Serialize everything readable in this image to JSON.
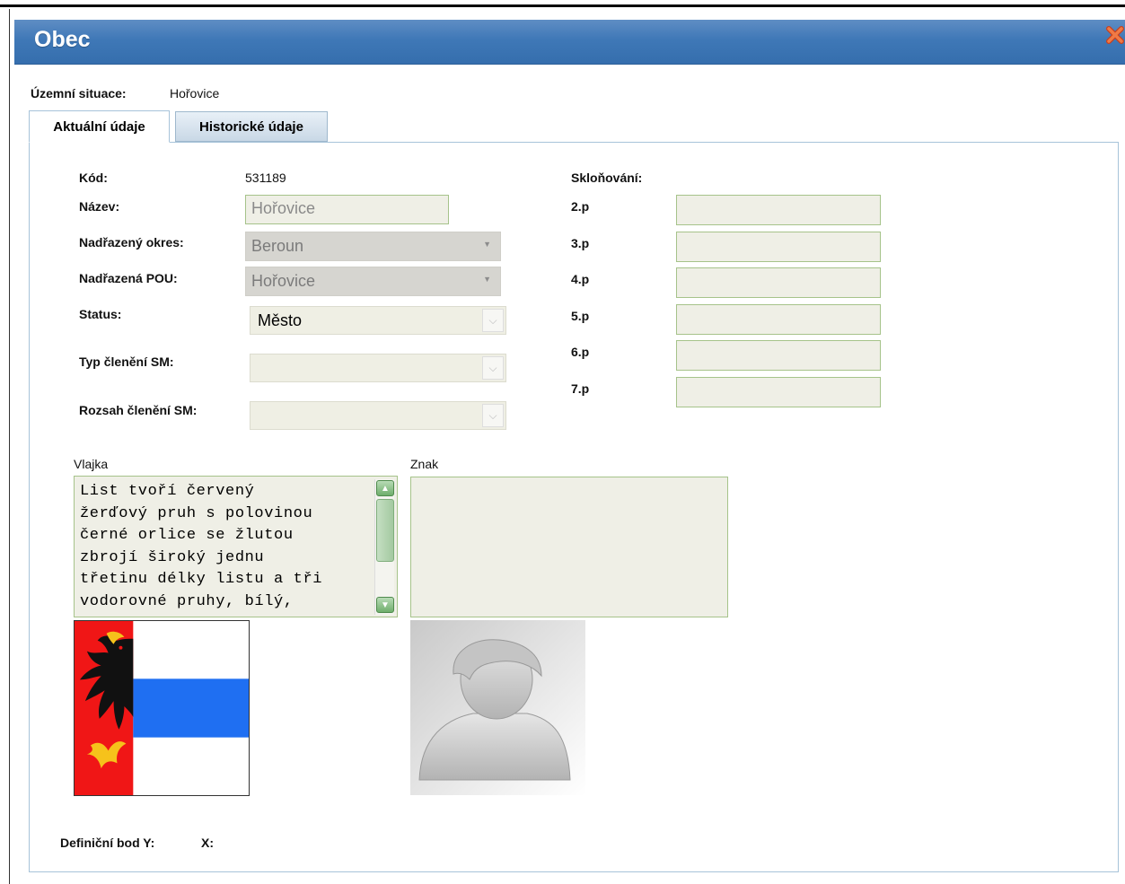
{
  "window": {
    "title": "Obec"
  },
  "territorial_situation": {
    "label": "Územní situace:",
    "value": "Hořovice"
  },
  "tabs": [
    {
      "label": "Aktuální údaje",
      "active": true
    },
    {
      "label": "Historické údaje",
      "active": false
    }
  ],
  "form": {
    "kod_label": "Kód:",
    "kod_value": "531189",
    "nazev_label": "Název:",
    "nazev_value": "Hořovice",
    "okres_label": "Nadřazený okres:",
    "okres_value": "Beroun",
    "pou_label": "Nadřazená POU:",
    "pou_value": "Hořovice",
    "status_label": "Status:",
    "status_value": "Město",
    "typ_label": "Typ členění SM:",
    "typ_value": "",
    "rozsah_label": "Rozsah členění SM:",
    "rozsah_value": ""
  },
  "declension": {
    "label": "Skloňování:",
    "cases": [
      {
        "label": "2.p",
        "value": ""
      },
      {
        "label": "3.p",
        "value": ""
      },
      {
        "label": "4.p",
        "value": ""
      },
      {
        "label": "5.p",
        "value": ""
      },
      {
        "label": "6.p",
        "value": ""
      },
      {
        "label": "7.p",
        "value": ""
      }
    ]
  },
  "vlajka": {
    "label": "Vlajka",
    "text_lines": [
      "List tvoří červený",
      "žerďový pruh s polovinou",
      "černé orlice se žlutou",
      "zbrojí široký jednu",
      "třetinu délky listu a tři",
      "vodorovné pruhy, bílý,"
    ]
  },
  "znak": {
    "label": "Znak",
    "value": ""
  },
  "definition_point": {
    "y_label": "Definiční bod Y:",
    "x_label": "X:"
  },
  "colors": {
    "titlebar": "#3f78b7",
    "field_border": "#a6c38a",
    "field_bg": "#efefe6",
    "flag_red": "#f01616",
    "flag_blue": "#1f6ff2",
    "close_icon": "#e4572e"
  },
  "icons": {
    "close": "close-icon",
    "combo_arrow": "chevron-down-icon",
    "scroll_up": "chevron-up-icon",
    "scroll_down": "chevron-down-icon",
    "avatar": "user-placeholder-icon"
  }
}
